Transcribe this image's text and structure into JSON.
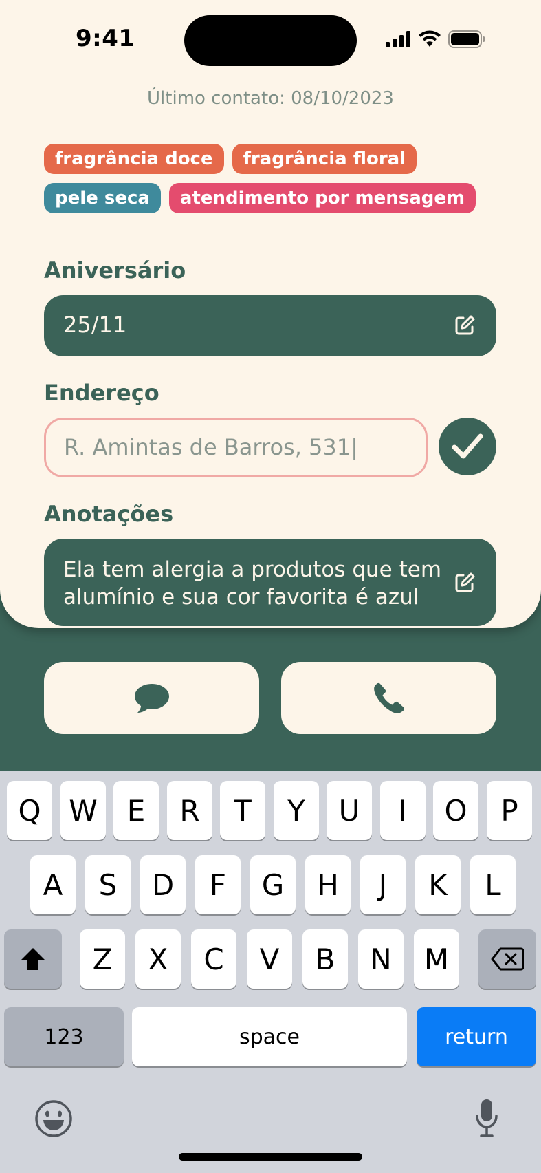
{
  "status_bar": {
    "time": "9:41"
  },
  "last_contact": "Último contato: 08/10/2023",
  "tags": [
    [
      {
        "label": "fragrância doce",
        "color": "#e5694a"
      },
      {
        "label": "fragrância floral",
        "color": "#e5694a"
      }
    ],
    [
      {
        "label": "pele seca",
        "color": "#3f8a9c"
      },
      {
        "label": "atendimento por mensagem",
        "color": "#e44c6e"
      }
    ]
  ],
  "birthday": {
    "label": "Aniversário",
    "value": "25/11"
  },
  "address": {
    "label": "Endereço",
    "value": "R. Amintas de Barros, 531|"
  },
  "notes": {
    "label": "Anotações",
    "value_line1": "Ela tem alergia a produtos que tem",
    "value_line2": "alumínio e sua cor favorita é azul"
  },
  "actions": {
    "message_icon": "chat-bubble-icon",
    "phone_icon": "phone-icon"
  },
  "keyboard": {
    "row1": [
      "Q",
      "W",
      "E",
      "R",
      "T",
      "Y",
      "U",
      "I",
      "O",
      "P"
    ],
    "row2": [
      "A",
      "S",
      "D",
      "F",
      "G",
      "H",
      "J",
      "K",
      "L"
    ],
    "row3": [
      "Z",
      "X",
      "C",
      "V",
      "B",
      "N",
      "M"
    ],
    "numbers": "123",
    "space": "space",
    "return": "return"
  },
  "colors": {
    "primary": "#3b6358",
    "background": "#fdf5e9",
    "accent_blue": "#0a7cf6"
  }
}
